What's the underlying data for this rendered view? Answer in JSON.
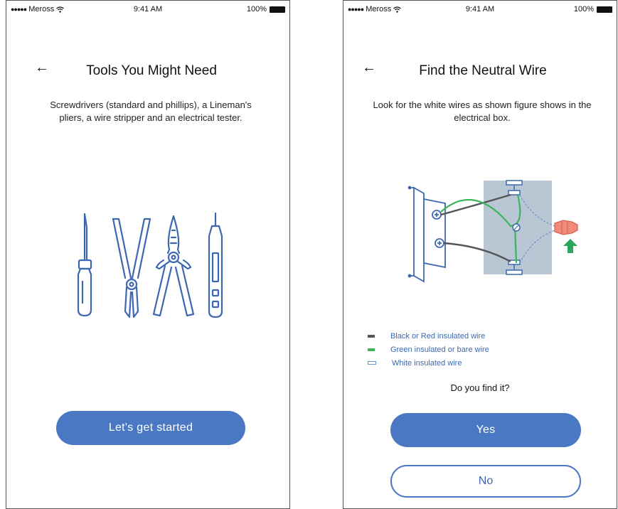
{
  "screens": [
    {
      "status": {
        "carrier": "Meross",
        "time": "9:41 AM",
        "battery": "100%"
      },
      "title": "Tools You Might Need",
      "description": "Screwdrivers (standard and phillips), a Lineman's pliers, a wire stripper and an electrical tester.",
      "primary_button": "Let's get started"
    },
    {
      "status": {
        "carrier": "Meross",
        "time": "9:41 AM",
        "battery": "100%"
      },
      "title": "Find the Neutral Wire",
      "description": "Look for the white wires as shown figure shows in the electrical box.",
      "legend": [
        {
          "label": "Black or Red insulated wire",
          "color": "#555555"
        },
        {
          "label": "Green insulated or bare wire",
          "color": "#3cb55e"
        },
        {
          "label": "White insulated wire",
          "color": "#ffffff"
        }
      ],
      "question": "Do you find it?",
      "yes_button": "Yes",
      "no_button": "No"
    }
  ],
  "colors": {
    "accent": "#4a78c2",
    "illustration_line": "#3d68b0",
    "box_fill": "#b9c6d4",
    "nut": "#f08a7a",
    "arrow": "#2aa55a"
  },
  "icons": [
    "back-arrow-icon",
    "wifi-icon",
    "battery-icon",
    "signal-dots-icon"
  ]
}
